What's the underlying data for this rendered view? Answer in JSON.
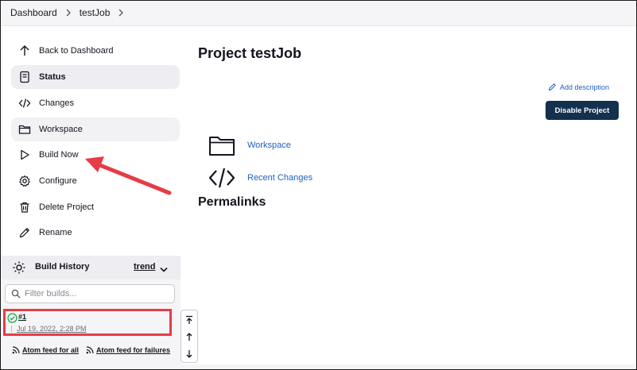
{
  "breadcrumb": {
    "items": [
      "Dashboard",
      "testJob"
    ]
  },
  "sidebar": {
    "items": [
      {
        "label": "Back to Dashboard",
        "icon": "arrow-up-icon"
      },
      {
        "label": "Status",
        "icon": "document-icon"
      },
      {
        "label": "Changes",
        "icon": "code-icon"
      },
      {
        "label": "Workspace",
        "icon": "folder-icon"
      },
      {
        "label": "Build Now",
        "icon": "play-icon"
      },
      {
        "label": "Configure",
        "icon": "gear-icon"
      },
      {
        "label": "Delete Project",
        "icon": "trash-icon"
      },
      {
        "label": "Rename",
        "icon": "pencil-icon"
      }
    ]
  },
  "build_history": {
    "title": "Build History",
    "trend_label": "trend",
    "filter_placeholder": "Filter builds...",
    "builds": [
      {
        "number": "#1",
        "date": "Jul 19, 2022, 2:28 PM",
        "status": "success"
      }
    ],
    "feeds": {
      "all": "Atom feed for all",
      "failures": "Atom feed for failures"
    }
  },
  "main": {
    "title": "Project testJob",
    "add_description": "Add description",
    "disable_button": "Disable Project",
    "links": [
      {
        "label": "Workspace",
        "icon": "folder-icon"
      },
      {
        "label": "Recent Changes",
        "icon": "code-icon"
      }
    ],
    "permalinks_heading": "Permalinks"
  },
  "colors": {
    "accent_dark": "#13304e",
    "link": "#1f5fbf",
    "annotation": "#e53c46",
    "success": "#1ea64b"
  }
}
